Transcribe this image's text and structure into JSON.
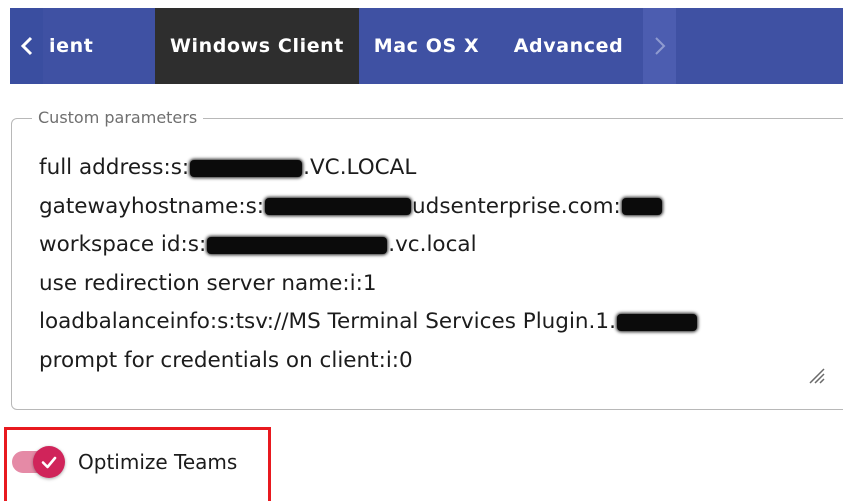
{
  "tabs": {
    "items": [
      {
        "label": "ient",
        "active": false
      },
      {
        "label": "Windows Client",
        "active": true
      },
      {
        "label": "Mac OS X",
        "active": false
      },
      {
        "label": "Advanced",
        "active": false
      }
    ],
    "accent_color": "#3f51a3",
    "active_color": "#2e2e2e"
  },
  "custom_parameters": {
    "legend": "Custom parameters",
    "lines": [
      {
        "prefix": "full address:s:",
        "suffix": ".VC.LOCAL"
      },
      {
        "prefix": "gatewayhostname:s:",
        "middle": "udsenterprise.com:",
        "suffix": ""
      },
      {
        "prefix": "workspace id:s:",
        "suffix": ".vc.local"
      },
      {
        "prefix": "use redirection server name:i:1"
      },
      {
        "prefix": "loadbalanceinfo:s:tsv://MS Terminal Services Plugin.1."
      },
      {
        "prefix": "prompt for credentials on client:i:0"
      }
    ]
  },
  "optimize_teams": {
    "label": "Optimize Teams",
    "checked": true,
    "toggle_color": "#d0245a"
  },
  "highlight_color": "#e8191f"
}
